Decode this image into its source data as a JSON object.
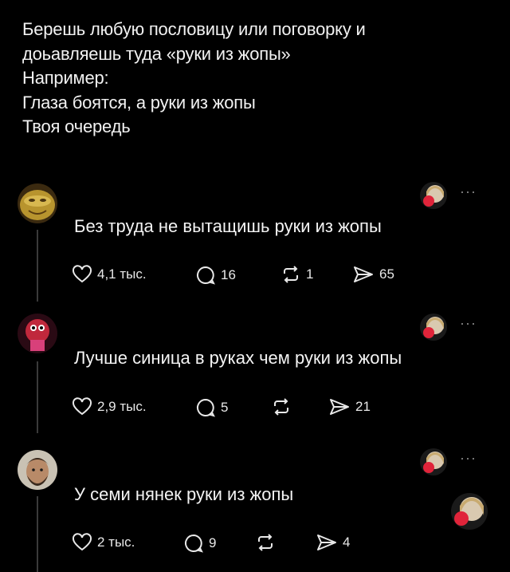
{
  "post": {
    "lines": [
      "Берешь любую пословицу или поговорку и",
      "доьавляешь туда «руки из жопы»",
      "Например:",
      "Глаза боятся, а руки из жопы",
      "Твоя очередь"
    ]
  },
  "replies": [
    {
      "text": "Без труда не вытащишь руки из жопы",
      "more": "···",
      "likes": "4,1 тыс.",
      "comments": "16",
      "reposts": "1",
      "shares": "65"
    },
    {
      "text": "Лучше синица в руках чем руки из жопы",
      "more": "···",
      "likes": "2,9 тыс.",
      "comments": "5",
      "reposts": "",
      "shares": "21"
    },
    {
      "text": "У семи нянек руки из жопы",
      "more": "···",
      "likes": "2 тыс.",
      "comments": "9",
      "reposts": "",
      "shares": "4"
    }
  ],
  "icons": {
    "like": "heart-icon",
    "comment": "comment-icon",
    "repost": "repost-icon",
    "share": "send-icon",
    "liked_badge": "red-heart-icon"
  },
  "colors": {
    "background": "#000000",
    "text": "#f2f2f2",
    "muted": "#8a8a8a",
    "heart": "#e0243a"
  }
}
